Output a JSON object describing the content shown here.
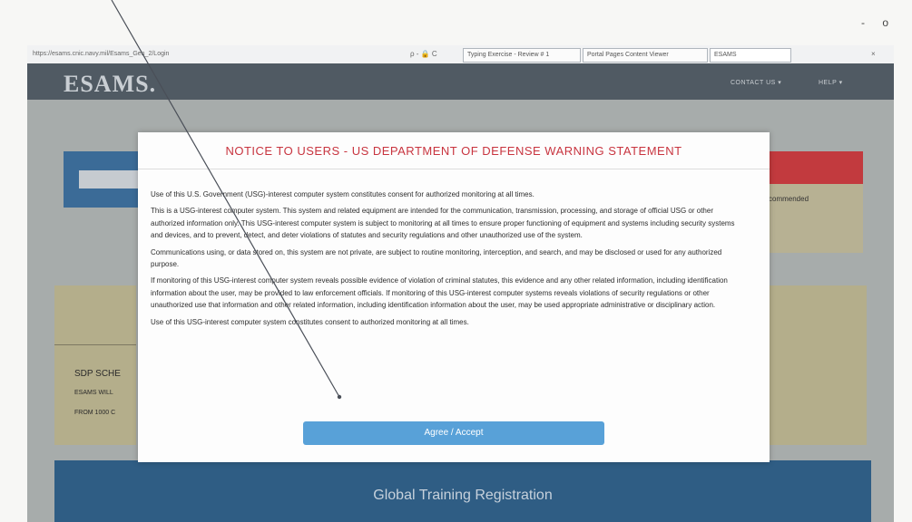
{
  "window": {
    "controls": "- o"
  },
  "browser": {
    "url": "https://esams.cnic.navy.mil/Esams_Gen_2/Login",
    "tools": "ρ - 🔒 C",
    "tabs": [
      {
        "label": "Typing Exercise - Review # 1"
      },
      {
        "label": "Portal Pages Content Viewer"
      },
      {
        "label": "ESAMS"
      }
    ],
    "close_tab": "×"
  },
  "header": {
    "logo": "ESAMS.",
    "nav": [
      {
        "label": "CONTACT US ▾"
      },
      {
        "label": "HELP ▾"
      }
    ]
  },
  "background": {
    "recommended_text": "commended",
    "sdp_title": "SDP SCHE",
    "sdp_line1": "ESAMS WILL",
    "sdp_line2": "FROM 1000 C",
    "footer_title": "Global Training Registration"
  },
  "modal": {
    "title": "NOTICE TO USERS - US DEPARTMENT OF DEFENSE WARNING STATEMENT",
    "paragraphs": [
      "Use of this U.S. Government (USG)-interest computer system constitutes consent for authorized monitoring at all times.",
      "This is a USG-interest computer system. This system and related equipment are intended for the communication, transmission, processing, and storage of official USG or other authorized information only. This USG-interest computer system is subject to monitoring at all times to ensure proper functioning of equipment and systems including security systems and devices, and to prevent, detect, and deter violations of statutes and security regulations and other unauthorized use of the system.",
      "Communications using, or data stored on, this system are not private, are subject to routine monitoring, interception, and search, and may be disclosed or used for any authorized purpose.",
      "If monitoring of this USG-interest computer system reveals possible evidence of violation of criminal statutes, this evidence and any other related information, including identification information about the user, may be provided to law enforcement officials. If monitoring of this USG-interest computer systems reveals violations of security regulations or other unauthorized use that information and other related information, including identification information about the user, may be used appropriate administrative or disciplinary action.",
      "Use of this USG-interest computer system constitutes consent to authorized monitoring at all times."
    ],
    "accept_label": "Agree / Accept"
  }
}
